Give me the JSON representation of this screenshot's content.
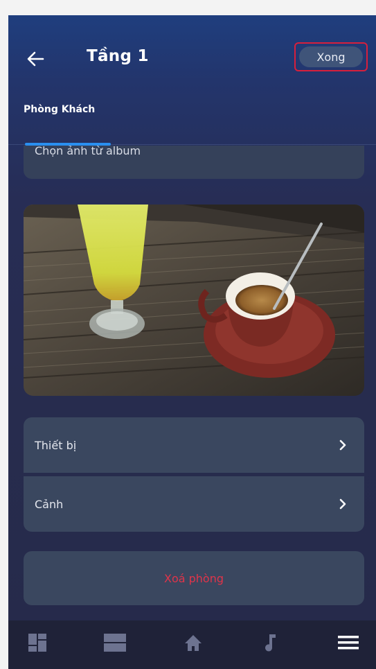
{
  "header": {
    "back_icon": "arrow-left-icon",
    "title": "Tầng 1",
    "done_label": "Xong",
    "done_border_color": "#d81f3c"
  },
  "tabs": [
    {
      "label": "Phòng Khách",
      "active": true,
      "indicator_color": "#2a8ff0"
    }
  ],
  "main": {
    "album_button_label": "Chọn ảnh từ album",
    "photo_icon": "room-photo-coffee-and-beer",
    "menu_items": [
      {
        "label": "Thiết bị",
        "icon": "chevron-right-icon"
      },
      {
        "label": "Cảnh",
        "icon": "chevron-right-icon"
      }
    ],
    "delete_label": "Xoá phòng",
    "delete_color": "#e0344a"
  },
  "bottom_nav": [
    {
      "icon": "dashboard-icon"
    },
    {
      "icon": "rooms-list-icon"
    },
    {
      "icon": "home-icon"
    },
    {
      "icon": "music-note-icon"
    },
    {
      "icon": "menu-icon"
    }
  ]
}
